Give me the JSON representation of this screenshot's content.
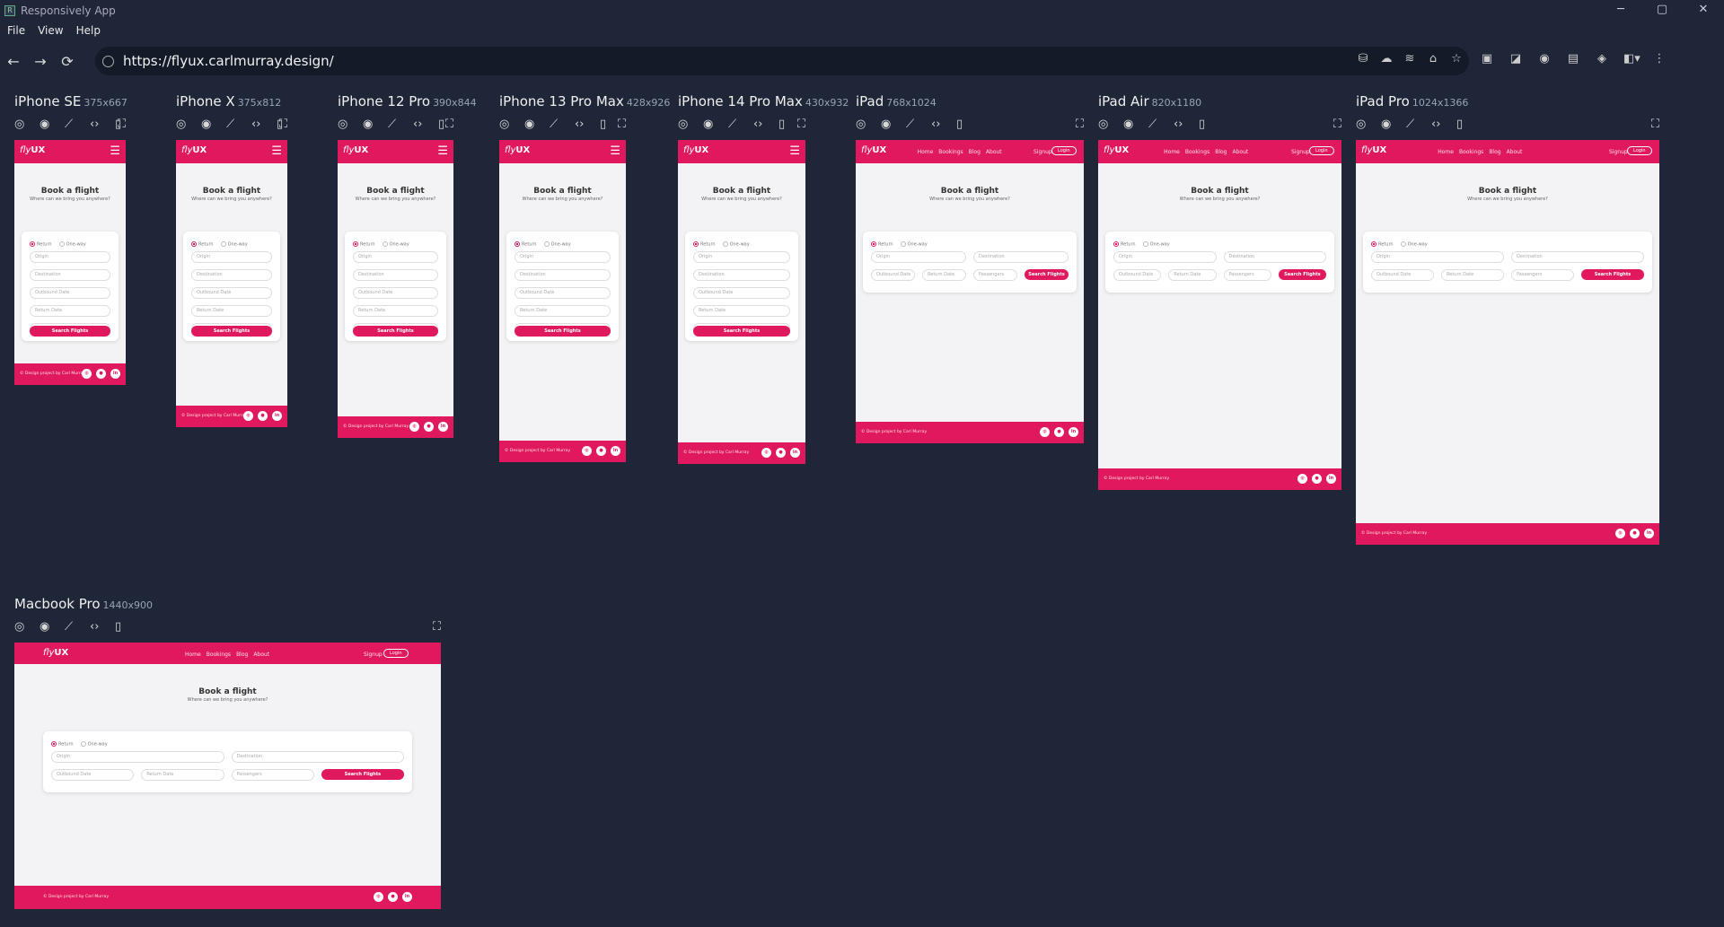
{
  "app": {
    "title": "Responsively App",
    "menu": [
      "File",
      "View",
      "Help"
    ],
    "url": "https://flyux.carlmurray.design/"
  },
  "tools": {
    "back": "←",
    "forward": "→",
    "reload": "⟳",
    "window_min": "─",
    "window_max": "▢",
    "window_close": "✕"
  },
  "site": {
    "logo_fly": "fly",
    "logo_ux": "UX",
    "nav": [
      "Home",
      "Bookings",
      "Blog",
      "About"
    ],
    "signup": "Signup",
    "login": "Login",
    "title": "Book a flight",
    "subtitle": "Where can we bring you anywhere?",
    "radio_return": "Return",
    "radio_oneway": "One-way",
    "origin": "Origin",
    "destination": "Destination",
    "outbound": "Outbound Date",
    "return_date": "Return Date",
    "passengers": "Passengers",
    "search": "Search Flights",
    "footer": "© Design project by Carl Murray"
  },
  "devices": [
    {
      "name": "iPhone SE",
      "size": "375x667"
    },
    {
      "name": "iPhone X",
      "size": "375x812"
    },
    {
      "name": "iPhone 12 Pro",
      "size": "390x844"
    },
    {
      "name": "iPhone 13 Pro Max",
      "size": "428x926"
    },
    {
      "name": "iPhone 14 Pro Max",
      "size": "430x932"
    },
    {
      "name": "iPad",
      "size": "768x1024"
    },
    {
      "name": "iPad Air",
      "size": "820x1180"
    },
    {
      "name": "iPad Pro",
      "size": "1024x1366"
    },
    {
      "name": "Macbook Pro",
      "size": "1440x900"
    }
  ]
}
